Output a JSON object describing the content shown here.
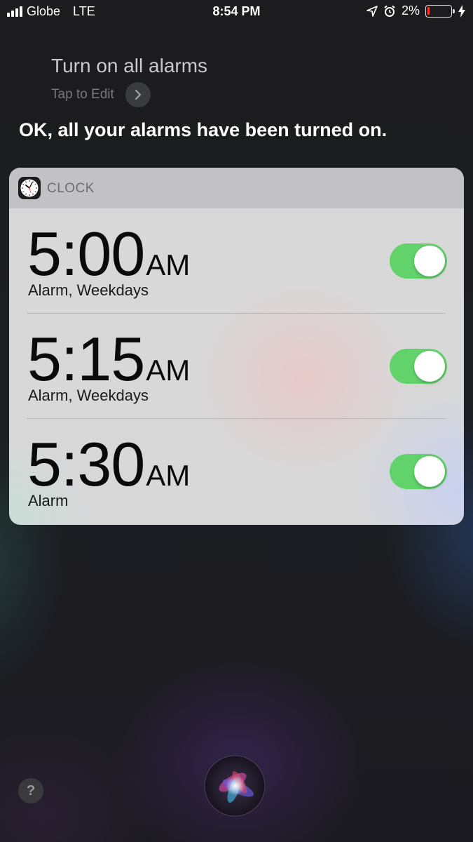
{
  "status_bar": {
    "carrier": "Globe",
    "network": "LTE",
    "time": "8:54 PM",
    "battery_percent": "2%",
    "icons": [
      "signal-bars-icon",
      "location-arrow-icon",
      "alarm-clock-icon",
      "battery-icon",
      "charging-bolt-icon"
    ]
  },
  "siri": {
    "query": "Turn on all alarms",
    "tap_to_edit": "Tap to Edit",
    "response": "OK, all your alarms have been turned on."
  },
  "card": {
    "app_name": "CLOCK",
    "alarms": [
      {
        "time": "5:00",
        "ampm": "AM",
        "label": "Alarm, Weekdays",
        "enabled": true
      },
      {
        "time": "5:15",
        "ampm": "AM",
        "label": "Alarm, Weekdays",
        "enabled": true
      },
      {
        "time": "5:30",
        "ampm": "AM",
        "label": "Alarm",
        "enabled": true
      }
    ]
  },
  "bottom": {
    "help_label": "?"
  },
  "colors": {
    "toggle_on": "#61d36a",
    "battery_low": "#ff3b30"
  }
}
